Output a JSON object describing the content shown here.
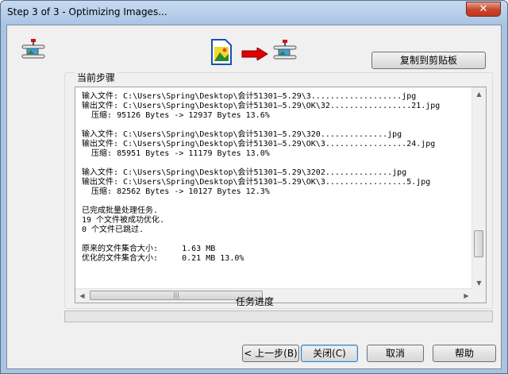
{
  "window": {
    "title": "Step 3 of 3 - Optimizing Images...",
    "close_glyph": "✕"
  },
  "icons": {
    "left_tool": "image-clamp-icon",
    "source": "image-file-icon",
    "arrow": "red-arrow-right-icon",
    "target": "image-clamp-icon"
  },
  "toolbar": {
    "copy_label": "复制到剪贴板"
  },
  "current_step": {
    "label": "当前步骤",
    "lines": [
      "输入文件: C:\\Users\\Spring\\Desktop\\会计51301—5.29\\3...................jpg",
      "输出文件: C:\\Users\\Spring\\Desktop\\会计51301—5.29\\OK\\32.................21.jpg",
      "  压缩: 95126 Bytes -> 12937 Bytes 13.6%",
      "",
      "输入文件: C:\\Users\\Spring\\Desktop\\会计51301—5.29\\320..............jpg",
      "输出文件: C:\\Users\\Spring\\Desktop\\会计51301—5.29\\OK\\3.................24.jpg",
      "  压缩: 85951 Bytes -> 11179 Bytes 13.0%",
      "",
      "输入文件: C:\\Users\\Spring\\Desktop\\会计51301—5.29\\3202..............jpg",
      "输出文件: C:\\Users\\Spring\\Desktop\\会计51301—5.29\\OK\\3.................5.jpg",
      "  压缩: 82562 Bytes -> 10127 Bytes 12.3%",
      "",
      "已完成批量处理任务.",
      "19 个文件被成功优化.",
      "0 个文件已跳过.",
      "",
      "原来的文件集合大小:     1.63 MB",
      "优化的文件集合大小:     0.21 MB 13.0%"
    ]
  },
  "progress": {
    "label": "任务进度",
    "value": 0
  },
  "buttons": {
    "back": "< 上一步(B)",
    "close": "关闭(C)",
    "cancel": "取消",
    "help": "帮助"
  },
  "colors": {
    "accent_red": "#e00000",
    "progress_green": "#06b025"
  }
}
